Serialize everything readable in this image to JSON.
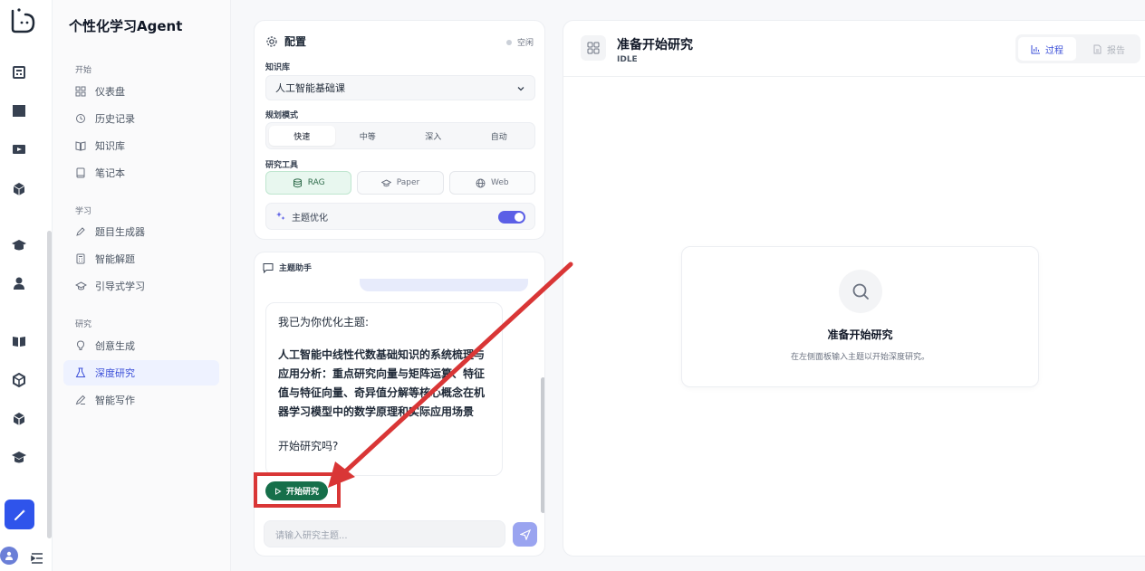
{
  "nav": {
    "brand": "个性化学习Agent",
    "sections": [
      {
        "title": "开始",
        "items": [
          {
            "label": "仪表盘",
            "icon": "dashboard-icon"
          },
          {
            "label": "历史记录",
            "icon": "history-icon"
          },
          {
            "label": "知识库",
            "icon": "book-icon"
          },
          {
            "label": "笔记本",
            "icon": "notebook-icon"
          }
        ]
      },
      {
        "title": "学习",
        "items": [
          {
            "label": "题目生成器",
            "icon": "pen-icon"
          },
          {
            "label": "智能解题",
            "icon": "calculator-icon"
          },
          {
            "label": "引导式学习",
            "icon": "graduation-cap-icon"
          }
        ]
      },
      {
        "title": "研究",
        "items": [
          {
            "label": "创意生成",
            "icon": "lightbulb-icon"
          },
          {
            "label": "深度研究",
            "icon": "flask-icon",
            "active": true
          },
          {
            "label": "智能写作",
            "icon": "edit-icon"
          }
        ]
      }
    ]
  },
  "config": {
    "title": "配置",
    "status": "空闲",
    "kb_label": "知识库",
    "kb_value": "人工智能基础课",
    "mode_label": "规划模式",
    "modes": [
      "快速",
      "中等",
      "深入",
      "自动"
    ],
    "selected_mode": "快速",
    "tools_label": "研究工具",
    "tools": [
      {
        "label": "RAG",
        "active": true
      },
      {
        "label": "Paper",
        "active": false
      },
      {
        "label": "Web",
        "active": false
      }
    ],
    "topic_opt_label": "主题优化",
    "topic_opt_enabled": true
  },
  "assistant": {
    "title": "主题助手",
    "message_intro": "我已为你优化主题:",
    "message_topic": "人工智能中线性代数基础知识的系统梳理与应用分析：重点研究向量与矩阵运算、特征值与特征向量、奇异值分解等核心概念在机器学习模型中的数学原理和实际应用场景",
    "message_question": "开始研究吗?",
    "start_button": "开始研究",
    "input_placeholder": "请输入研究主题..."
  },
  "research": {
    "title": "准备开始研究",
    "status": "IDLE",
    "tabs": [
      "过程",
      "报告"
    ],
    "selected_tab": "过程",
    "empty_title": "准备开始研究",
    "empty_subtitle": "在左侧面板输入主题以开始深度研究。"
  },
  "colors": {
    "accent": "#3b4fd8",
    "start_button": "#166f4a",
    "toggle": "#5b5fe6",
    "annotation": "#d93636"
  }
}
